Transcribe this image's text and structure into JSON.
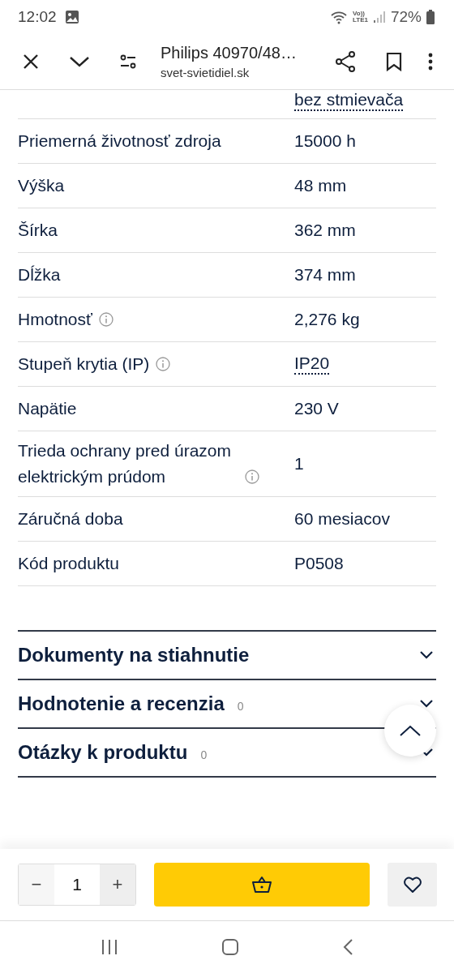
{
  "status_bar": {
    "time": "12:02",
    "network_labels": [
      "Vo))",
      "LTE1"
    ],
    "battery": "72%"
  },
  "browser_bar": {
    "title": "Philips 40970/48…",
    "domain": "svet-svietidiel.sk"
  },
  "specs": [
    {
      "value": "bez stmievača",
      "info": false,
      "underlined": true
    },
    {
      "label": "Priemerná životnosť zdroja",
      "value": "15000 h",
      "info": false,
      "underlined": false
    },
    {
      "label": "Výška",
      "value": "48 mm",
      "info": false,
      "underlined": false
    },
    {
      "label": "Šírka",
      "value": "362 mm",
      "info": false,
      "underlined": false
    },
    {
      "label": "Dĺžka",
      "value": "374 mm",
      "info": false,
      "underlined": false
    },
    {
      "label": "Hmotnosť",
      "value": "2,276 kg",
      "info": true,
      "underlined": false
    },
    {
      "label": "Stupeň krytia (IP)",
      "value": "IP20",
      "info": true,
      "underlined": true
    },
    {
      "label": "Napätie",
      "value": "230 V",
      "info": false,
      "underlined": false
    },
    {
      "label": "Trieda ochrany pred úrazom elektrickým prúdom",
      "value": "1",
      "info": true,
      "underlined": false
    },
    {
      "label": "Záručná doba",
      "value": "60 mesiacov",
      "info": false,
      "underlined": false
    },
    {
      "label": "Kód produktu",
      "value": "P0508",
      "info": false,
      "underlined": false
    }
  ],
  "accordions": [
    {
      "title": "Dokumenty na stiahnutie",
      "expanded": false
    },
    {
      "title": "Hodnotenie a recenzia",
      "count": "0",
      "expanded": false
    },
    {
      "title": "Otázky k produktu",
      "count": "0",
      "expanded": false
    }
  ],
  "cart": {
    "minus": "−",
    "quantity": "1",
    "plus": "+"
  }
}
